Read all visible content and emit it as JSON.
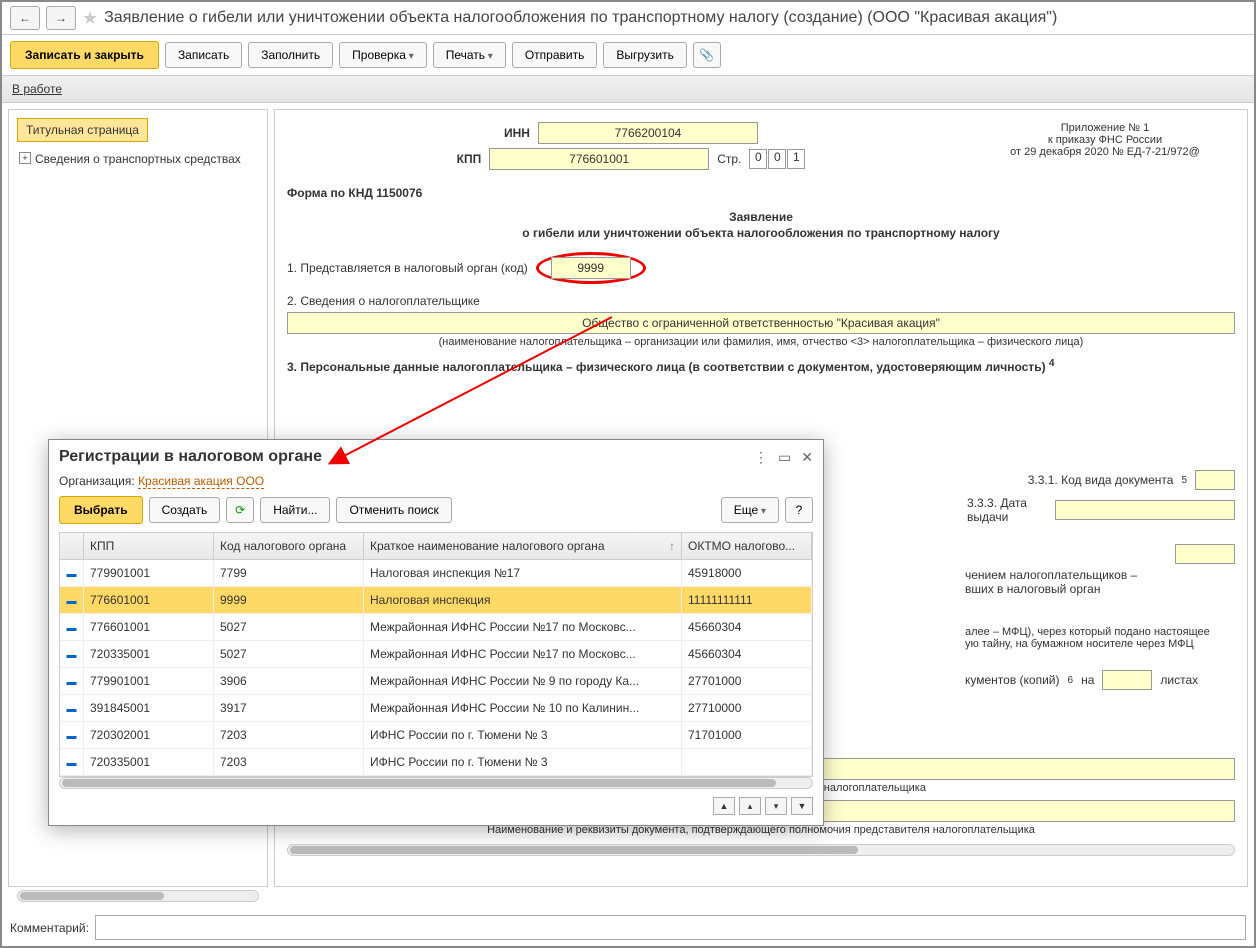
{
  "title": "Заявление о гибели или уничтожении объекта налогообложения по транспортному налогу (создание) (ООО \"Красивая акация\")",
  "toolbar": {
    "save_close": "Записать и закрыть",
    "save": "Записать",
    "fill": "Заполнить",
    "check": "Проверка",
    "print": "Печать",
    "send": "Отправить",
    "export": "Выгрузить"
  },
  "status": "В работе",
  "sidebar": {
    "title_tab": "Титульная страница",
    "item1": "Сведения о транспортных средствах"
  },
  "form": {
    "inn_label": "ИНН",
    "inn": "7766200104",
    "kpp_label": "КПП",
    "kpp": "776601001",
    "str_label": "Стр.",
    "str0": "0",
    "str1": "0",
    "str2": "1",
    "appendix1": "Приложение № 1",
    "appendix2": "к приказу ФНС России",
    "appendix3": "от 29 декабря 2020 № ЕД-7-21/972@",
    "knd": "Форма по КНД 1150076",
    "decl_title": "Заявление",
    "decl_sub": "о гибели или уничтожении объекта налогообложения по транспортному налогу",
    "line1": "1. Представляется в налоговый орган (код)",
    "code": "9999",
    "line2": "2. Сведения о налогоплательщике",
    "org_name": "Общество с ограниченной ответственностью \"Красивая акация\"",
    "org_hint": "(наименование налогоплательщика – организации или фамилия, имя, отчество <3> налогоплательщика – физического лица)",
    "line3": "3. Персональные данные налогоплательщика – физического лица (в соответствии с документом, удостоверяющим личность)",
    "line3sup": "4",
    "line331": "3.3.1. Код вида документа",
    "line331sup": "5",
    "line333": "3.3.3. Дата выдачи",
    "hidden1": "чением налогоплательщиков –",
    "hidden2": "вших в налоговый орган",
    "mfc1": "алее – МФЦ), через который подано настоящее",
    "mfc2": "ую тайну, на бумажном носителе через МФЦ",
    "docs1": "кументов (копий)",
    "docs1sup": "6",
    "docs2": "на",
    "docs3": "листах",
    "fio_hint": "Фамилия, имя, отчество <3> представителя налогоплательщика",
    "rekviz_hint": "Наименование и реквизиты документа, подтверждающего полномочия представителя налогоплательщика"
  },
  "dialog": {
    "title": "Регистрации в налоговом органе",
    "org_label": "Организация:",
    "org_value": "Красивая акация ООО",
    "select": "Выбрать",
    "create": "Создать",
    "find": "Найти...",
    "cancel_find": "Отменить поиск",
    "more": "Еще",
    "help": "?",
    "cols": {
      "kpp": "КПП",
      "code": "Код налогового органа",
      "name": "Краткое наименование налогового органа",
      "oktmo": "ОКТМО налогово..."
    },
    "rows": [
      {
        "kpp": "779901001",
        "code": "7799",
        "name": "Налоговая инспекция №17",
        "oktmo": "45918000",
        "sel": false
      },
      {
        "kpp": "776601001",
        "code": "9999",
        "name": "Налоговая инспекция",
        "oktmo": "11111111111",
        "sel": true
      },
      {
        "kpp": "776601001",
        "code": "5027",
        "name": "Межрайонная ИФНС России №17 по Московс...",
        "oktmo": "45660304",
        "sel": false
      },
      {
        "kpp": "720335001",
        "code": "5027",
        "name": "Межрайонная ИФНС России №17 по Московс...",
        "oktmo": "45660304",
        "sel": false
      },
      {
        "kpp": "779901001",
        "code": "3906",
        "name": "Межрайонная ИФНС России № 9 по городу Ка...",
        "oktmo": "27701000",
        "sel": false
      },
      {
        "kpp": "391845001",
        "code": "3917",
        "name": "Межрайонная ИФНС России № 10 по Калинин...",
        "oktmo": "27710000",
        "sel": false
      },
      {
        "kpp": "720302001",
        "code": "7203",
        "name": "ИФНС России по г. Тюмени № 3",
        "oktmo": "71701000",
        "sel": false
      },
      {
        "kpp": "720335001",
        "code": "7203",
        "name": "ИФНС России по г. Тюмени № 3",
        "oktmo": "",
        "sel": false
      }
    ]
  },
  "comment_label": "Комментарий:"
}
